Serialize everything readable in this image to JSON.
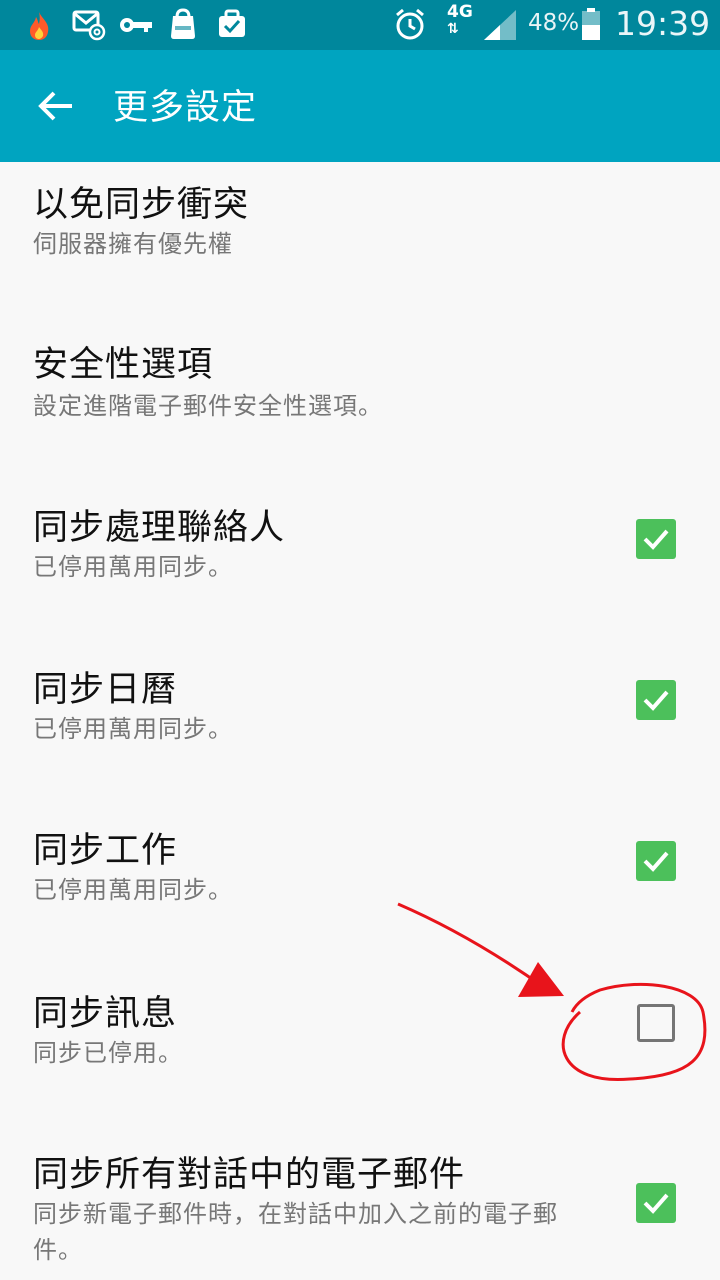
{
  "status_bar": {
    "battery_percent": "48%",
    "time": "19:39",
    "network": "4G",
    "icons": [
      "flame-icon",
      "email-icon",
      "key-icon",
      "galaxy-apps-icon",
      "briefcase-icon",
      "alarm-icon",
      "signal-icon",
      "battery-icon"
    ]
  },
  "app_bar": {
    "title": "更多設定",
    "back_icon": "arrow-back-icon"
  },
  "settings": [
    {
      "title": "以免同步衝突",
      "subtitle": "伺服器擁有優先權"
    },
    {
      "title": "安全性選項",
      "subtitle": "設定進階電子郵件安全性選項。"
    },
    {
      "title": "同步處理聯絡人",
      "subtitle": "已停用萬用同步。",
      "checked": true
    },
    {
      "title": "同步日曆",
      "subtitle": "已停用萬用同步。",
      "checked": true
    },
    {
      "title": "同步工作",
      "subtitle": "已停用萬用同步。",
      "checked": true
    },
    {
      "title": "同步訊息",
      "subtitle": "同步已停用。",
      "checked": false
    },
    {
      "title": "同步所有對話中的電子郵件",
      "subtitle": "同步新電子郵件時，在對話中加入之前的電子郵件。",
      "checked": true
    }
  ],
  "colors": {
    "status_bar": "#00879c",
    "app_bar": "#00a4c0",
    "checkbox_on": "#4cc05b",
    "annotation": "#e8141b"
  }
}
